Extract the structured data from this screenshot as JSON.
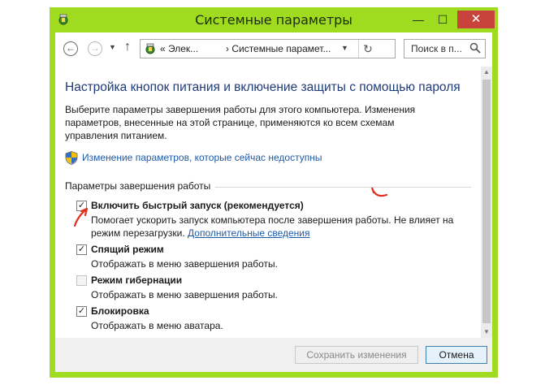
{
  "window": {
    "title": "Системные параметры",
    "minimize_glyph": "—",
    "maximize_glyph": "☐",
    "close_glyph": "✕",
    "accent_color": "#9fdc1f",
    "close_color": "#c7433c"
  },
  "nav": {
    "back_glyph": "←",
    "forward_glyph": "→",
    "history_glyph": "▼",
    "up_glyph": "↑",
    "address": {
      "crumb1": "« Элек...",
      "separator": "›",
      "crumb2": "› Системные парамет...",
      "dropdown_glyph": "▼",
      "refresh_glyph": "↻"
    },
    "search_placeholder": "Поиск в п..."
  },
  "main": {
    "heading": "Настройка кнопок питания и включение защиты с помощью пароля",
    "description": "Выберите параметры завершения работы для этого компьютера. Изменения параметров, внесенные на этой странице, применяются ко всем схемам управления питанием.",
    "change_link": "Изменение параметров, которые сейчас недоступны",
    "group_label": "Параметры завершения работы",
    "options": [
      {
        "label": "Включить быстрый запуск (рекомендуется)",
        "checked": true,
        "check_glyph": "✓",
        "desc_line1": "Помогает ускорить запуск компьютера после завершения работы. Не влияет на",
        "desc_line2": "режим перезагрузки.",
        "more_link": "Дополнительные сведения"
      },
      {
        "label": "Спящий режим",
        "checked": true,
        "check_glyph": "✓",
        "desc_line1": "Отображать в меню завершения работы."
      },
      {
        "label": "Режим гибернации",
        "checked": false,
        "check_glyph": "",
        "desc_line1": "Отображать в меню завершения работы."
      },
      {
        "label": "Блокировка",
        "checked": true,
        "check_glyph": "✓",
        "desc_line1": "Отображать в меню аватара."
      }
    ]
  },
  "footer": {
    "save_label": "Сохранить изменения",
    "cancel_label": "Отмена"
  },
  "scrollbar": {
    "up_glyph": "▲",
    "down_glyph": "▼"
  }
}
